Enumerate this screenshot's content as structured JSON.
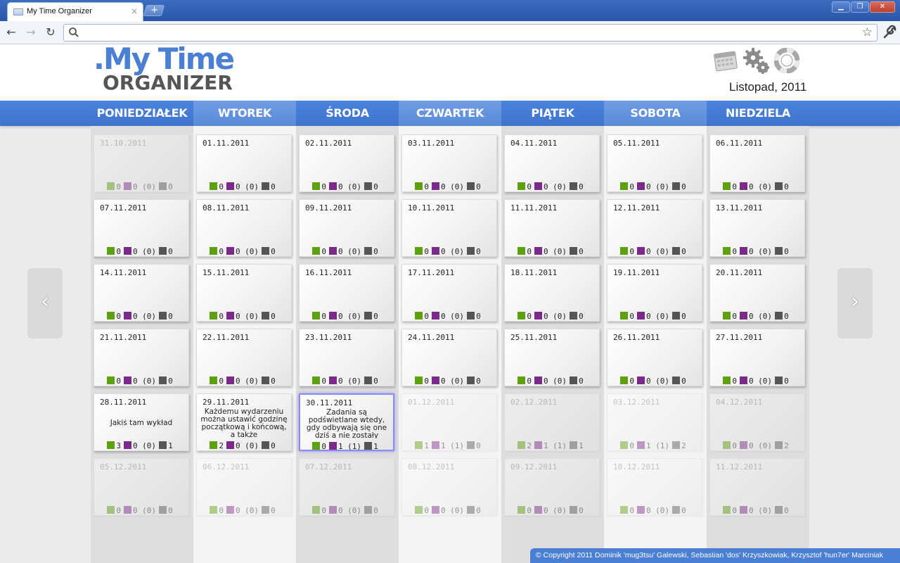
{
  "browser": {
    "tab_title": "My Time Organizer",
    "tab_close": "×",
    "new_tab": "+",
    "win_minimize": "▁",
    "win_restore": "❐",
    "win_close": "✕",
    "back": "←",
    "forward": "→",
    "reload": "↻",
    "url": "",
    "star": "☆",
    "wrench": "🔧"
  },
  "app": {
    "logo_top": ".My Time",
    "logo_bottom": "ORGANIZER",
    "month_label": "Listopad, 2011",
    "icons": [
      "calendar-icon",
      "settings-gears-icon",
      "help-lifebuoy-icon"
    ],
    "colors": {
      "accent": "#4a7fd4",
      "green": "#5ea00f",
      "purple": "#7a2a88",
      "gray": "#555555"
    }
  },
  "weekdays": [
    "PONIEDZIAŁEK",
    "WTOREK",
    "ŚRODA",
    "CZWARTEK",
    "PIĄTEK",
    "SOBOTA",
    "NIEDZIELA"
  ],
  "weeks": [
    [
      {
        "date": "31.10.2011",
        "inactive": true,
        "g": "0",
        "p": "0 (0)",
        "k": "0"
      },
      {
        "date": "01.11.2011",
        "g": "0",
        "p": "0 (0)",
        "k": "0"
      },
      {
        "date": "02.11.2011",
        "g": "0",
        "p": "0 (0)",
        "k": "0"
      },
      {
        "date": "03.11.2011",
        "g": "0",
        "p": "0 (0)",
        "k": "0"
      },
      {
        "date": "04.11.2011",
        "g": "0",
        "p": "0 (0)",
        "k": "0"
      },
      {
        "date": "05.11.2011",
        "g": "0",
        "p": "0 (0)",
        "k": "0"
      },
      {
        "date": "06.11.2011",
        "g": "0",
        "p": "0 (0)",
        "k": "0"
      }
    ],
    [
      {
        "date": "07.11.2011",
        "g": "0",
        "p": "0 (0)",
        "k": "0"
      },
      {
        "date": "08.11.2011",
        "g": "0",
        "p": "0 (0)",
        "k": "0"
      },
      {
        "date": "09.11.2011",
        "g": "0",
        "p": "0 (0)",
        "k": "0"
      },
      {
        "date": "10.11.2011",
        "g": "0",
        "p": "0 (0)",
        "k": "0"
      },
      {
        "date": "11.11.2011",
        "g": "0",
        "p": "0 (0)",
        "k": "0"
      },
      {
        "date": "12.11.2011",
        "g": "0",
        "p": "0 (0)",
        "k": "0"
      },
      {
        "date": "13.11.2011",
        "g": "0",
        "p": "0 (0)",
        "k": "0"
      }
    ],
    [
      {
        "date": "14.11.2011",
        "g": "0",
        "p": "0 (0)",
        "k": "0"
      },
      {
        "date": "15.11.2011",
        "g": "0",
        "p": "0 (0)",
        "k": "0"
      },
      {
        "date": "16.11.2011",
        "g": "0",
        "p": "0 (0)",
        "k": "0"
      },
      {
        "date": "17.11.2011",
        "g": "0",
        "p": "0 (0)",
        "k": "0"
      },
      {
        "date": "18.11.2011",
        "g": "0",
        "p": "0 (0)",
        "k": "0"
      },
      {
        "date": "19.11.2011",
        "g": "0",
        "p": "0 (0)",
        "k": "0"
      },
      {
        "date": "20.11.2011",
        "g": "0",
        "p": "0 (0)",
        "k": "0"
      }
    ],
    [
      {
        "date": "21.11.2011",
        "g": "0",
        "p": "0 (0)",
        "k": "0"
      },
      {
        "date": "22.11.2011",
        "g": "0",
        "p": "0 (0)",
        "k": "0"
      },
      {
        "date": "23.11.2011",
        "g": "0",
        "p": "0 (0)",
        "k": "0"
      },
      {
        "date": "24.11.2011",
        "g": "0",
        "p": "0 (0)",
        "k": "0"
      },
      {
        "date": "25.11.2011",
        "g": "0",
        "p": "0 (0)",
        "k": "0"
      },
      {
        "date": "26.11.2011",
        "g": "0",
        "p": "0 (0)",
        "k": "0"
      },
      {
        "date": "27.11.2011",
        "g": "0",
        "p": "0 (0)",
        "k": "0"
      }
    ],
    [
      {
        "date": "28.11.2011",
        "note": "Jakiś tam wykład",
        "g": "3",
        "p": "0 (0)",
        "k": "1"
      },
      {
        "date": "29.11.2011",
        "note": "Każdemu wydarzeniu można ustawić godzinę początkową i końcową, a także",
        "g": "2",
        "p": "0 (0)",
        "k": "0"
      },
      {
        "date": "30.11.2011",
        "today": true,
        "note": "Zadania są podświetlane wtedy, gdy odbywają się one dziś a nie zostały",
        "g": "0",
        "p": "1 (1)",
        "k": "1"
      },
      {
        "date": "01.12.2011",
        "inactive": true,
        "g": "1",
        "p": "1 (1)",
        "k": "0"
      },
      {
        "date": "02.12.2011",
        "inactive": true,
        "g": "2",
        "p": "1 (1)",
        "k": "1"
      },
      {
        "date": "03.12.2011",
        "inactive": true,
        "g": "0",
        "p": "1 (1)",
        "k": "2"
      },
      {
        "date": "04.12.2011",
        "inactive": true,
        "g": "0",
        "p": "0 (0)",
        "k": "2"
      }
    ],
    [
      {
        "date": "05.12.2011",
        "inactive": true,
        "g": "0",
        "p": "0 (0)",
        "k": "0"
      },
      {
        "date": "06.12.2011",
        "inactive": true,
        "g": "0",
        "p": "0 (0)",
        "k": "0"
      },
      {
        "date": "07.12.2011",
        "inactive": true,
        "g": "0",
        "p": "0 (0)",
        "k": "0"
      },
      {
        "date": "08.12.2011",
        "inactive": true,
        "g": "0",
        "p": "0 (0)",
        "k": "0"
      },
      {
        "date": "09.12.2011",
        "inactive": true,
        "g": "0",
        "p": "0 (0)",
        "k": "0"
      },
      {
        "date": "10.12.2011",
        "inactive": true,
        "g": "0",
        "p": "0 (0)",
        "k": "0"
      },
      {
        "date": "11.12.2011",
        "inactive": true,
        "g": "0",
        "p": "0 (0)",
        "k": "0"
      }
    ]
  ],
  "nav": {
    "prev": "‹",
    "next": "›"
  },
  "footer": "© Copyright 2011 Dominik 'mug3tsu' Galewski, Sebastian 'dos' Krzyszkowiak, Krzysztof 'hun7er' Marciniak"
}
